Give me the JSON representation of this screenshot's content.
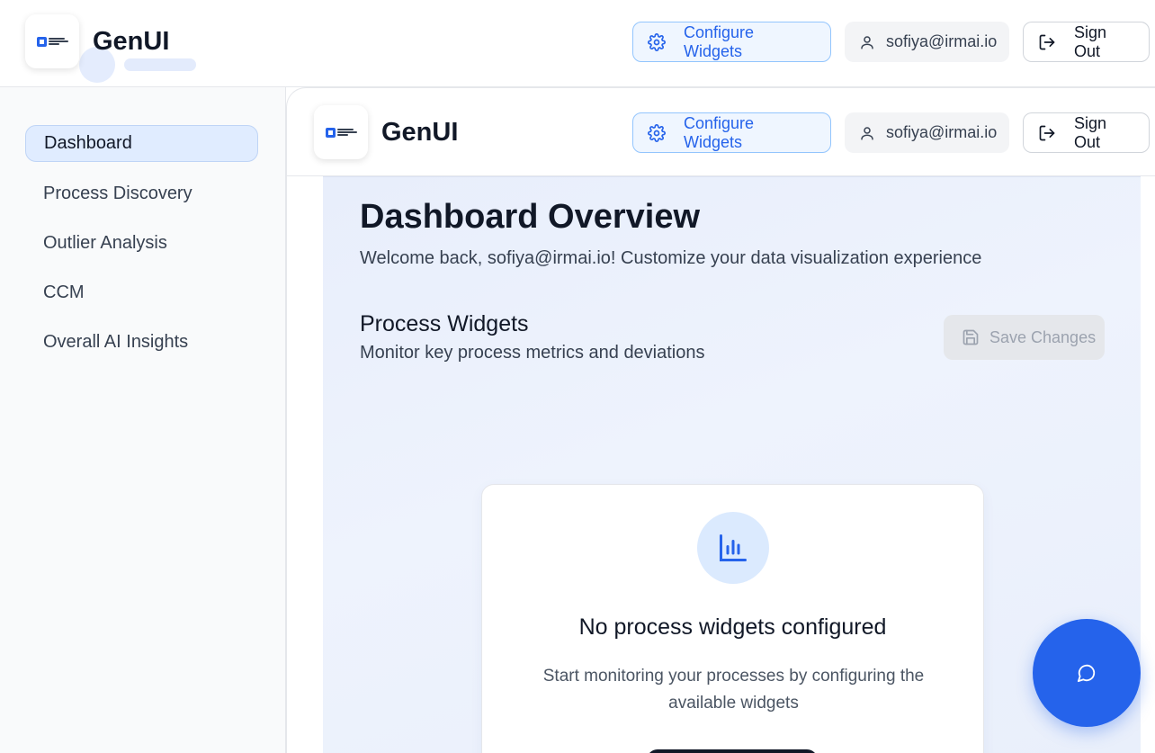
{
  "app": {
    "brand": "GenUI",
    "user_email": "sofiya@irmai.io",
    "configure_label": "Configure Widgets",
    "signout_label": "Sign Out"
  },
  "sidebar": {
    "items": [
      {
        "label": "Dashboard",
        "active": true
      },
      {
        "label": "Process Discovery",
        "active": false
      },
      {
        "label": "Outlier Analysis",
        "active": false
      },
      {
        "label": "CCM",
        "active": false
      },
      {
        "label": "Overall AI Insights",
        "active": false
      }
    ]
  },
  "main": {
    "title": "Dashboard Overview",
    "welcome": "Welcome back, sofiya@irmai.io! Customize your data visualization experience",
    "section_title": "Process Widgets",
    "section_sub": "Monitor key process metrics and deviations",
    "save_label": "Save Changes",
    "empty_title": "No process widgets configured",
    "empty_desc": "Start monitoring your processes by configuring the available widgets"
  },
  "colors": {
    "accent": "#2563eb",
    "active_nav_bg": "#e0ecff",
    "content_bg": "#eaf0fc"
  },
  "icons": {
    "settings": "gear-icon",
    "user": "user-icon",
    "signout": "logout-icon",
    "save": "save-icon",
    "chart": "bar-chart-icon",
    "chat": "chat-icon"
  }
}
